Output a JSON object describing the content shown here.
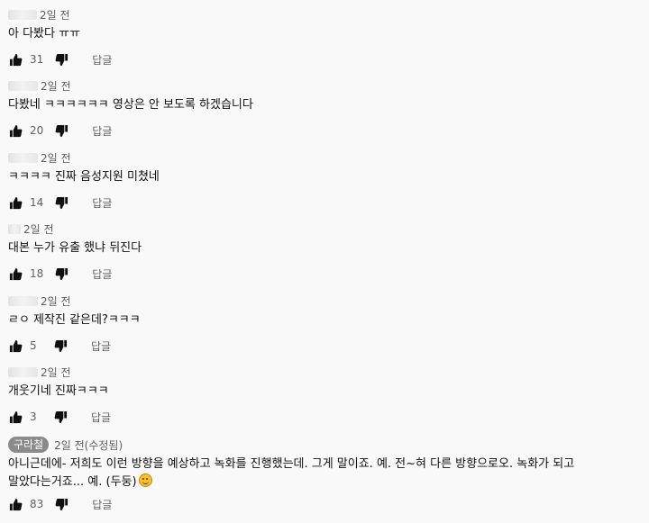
{
  "reply_label": "답글",
  "comments": [
    {
      "time": "2일 전",
      "text": "아 다봤다 ㅠㅠ",
      "likes": "31"
    },
    {
      "time": "2일 전",
      "text": "다봤네 ㅋㅋㅋㅋㅋㅋ 영상은 안 보도록 하겠습니다",
      "likes": "20"
    },
    {
      "time": "2일 전",
      "text": "ㅋㅋㅋㅋ 진짜 음성지원 미쳤네",
      "likes": "14"
    },
    {
      "time": "2일 전",
      "text": "대본 누가 유출 했냐 뒤진다",
      "likes": "18"
    },
    {
      "time": "2일 전",
      "text": "ㄹㅇ 제작진 같은데?ㅋㅋㅋ",
      "likes": "5"
    },
    {
      "time": "2일 전",
      "text": "개웃기네 진짜ㅋㅋㅋ",
      "likes": "3"
    },
    {
      "author": "구라철",
      "time": "2일 전(수정됨)",
      "text": "아니근데에- 저희도 이런 방향을 예상하고 녹화를 진행했는데. 그게 말이죠. 예. 전~혀 다른 방향으로오. 녹화가 되고 말았다는거죠... 예. (두둥)",
      "emoji": "grinning-face-emoji",
      "likes": "83"
    }
  ]
}
